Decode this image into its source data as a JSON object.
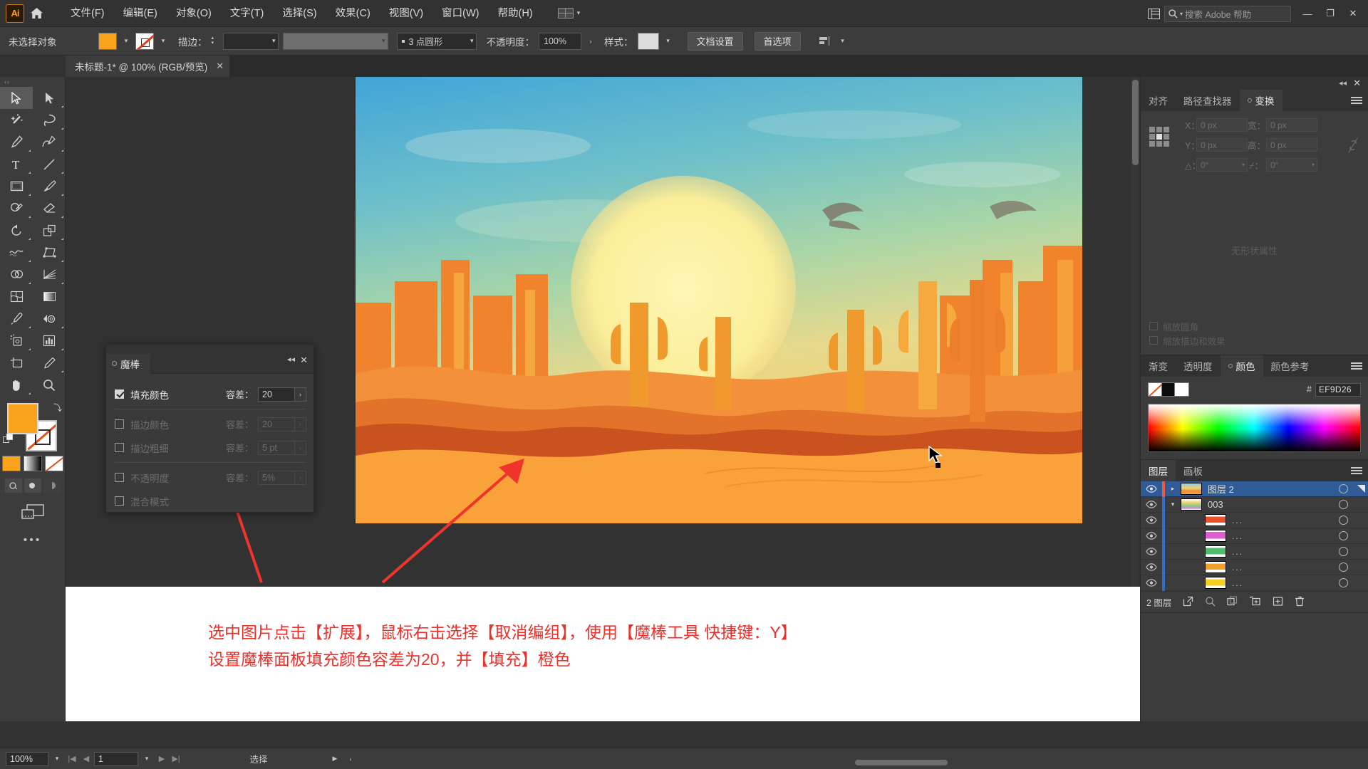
{
  "app": {
    "name": "Adobe Illustrator",
    "logo_text": "Ai"
  },
  "menubar": {
    "items": [
      "文件(F)",
      "编辑(E)",
      "对象(O)",
      "文字(T)",
      "选择(S)",
      "效果(C)",
      "视图(V)",
      "窗口(W)",
      "帮助(H)"
    ],
    "search_placeholder": "搜索 Adobe 帮助",
    "window_buttons": [
      "—",
      "❐",
      "✕"
    ]
  },
  "controlbar": {
    "selection_status": "未选择对象",
    "stroke_label": "描边：",
    "stroke_width": "",
    "stroke_profile": "",
    "brush_label": "3 点圆形",
    "opacity_label": "不透明度：",
    "opacity_value": "100%",
    "style_label": "样式：",
    "doc_setup_button": "文档设置",
    "preferences_button": "首选项"
  },
  "document_tab": {
    "title": "未标题-1* @ 100% (RGB/预览)",
    "close": "✕"
  },
  "toolbar": {
    "tools": [
      {
        "name": "selection-tool",
        "selected": true
      },
      {
        "name": "direct-selection-tool",
        "selected": false
      },
      {
        "name": "magic-wand-tool",
        "selected": false
      },
      {
        "name": "lasso-tool",
        "selected": false
      },
      {
        "name": "pen-tool",
        "selected": false
      },
      {
        "name": "curvature-tool",
        "selected": false
      },
      {
        "name": "type-tool",
        "selected": false
      },
      {
        "name": "line-segment-tool",
        "selected": false
      },
      {
        "name": "rectangle-tool",
        "selected": false
      },
      {
        "name": "paintbrush-tool",
        "selected": false
      },
      {
        "name": "shaper-tool",
        "selected": false
      },
      {
        "name": "eraser-tool",
        "selected": false
      },
      {
        "name": "rotate-tool",
        "selected": false
      },
      {
        "name": "scale-tool",
        "selected": false
      },
      {
        "name": "width-tool",
        "selected": false
      },
      {
        "name": "free-transform-tool",
        "selected": false
      },
      {
        "name": "shape-builder-tool",
        "selected": false
      },
      {
        "name": "perspective-grid-tool",
        "selected": false
      },
      {
        "name": "mesh-tool",
        "selected": false
      },
      {
        "name": "gradient-tool",
        "selected": false
      },
      {
        "name": "eyedropper-tool",
        "selected": false
      },
      {
        "name": "blend-tool",
        "selected": false
      },
      {
        "name": "symbol-sprayer-tool",
        "selected": false
      },
      {
        "name": "column-graph-tool",
        "selected": false
      },
      {
        "name": "artboard-tool",
        "selected": false
      },
      {
        "name": "slice-tool",
        "selected": false
      },
      {
        "name": "hand-tool",
        "selected": false
      },
      {
        "name": "zoom-tool",
        "selected": false
      }
    ],
    "fill_color": "#FBA21C",
    "stroke_color": "none",
    "more_tools": "•••"
  },
  "magic_wand_panel": {
    "tab_label": "魔棒",
    "close": "✕",
    "collapse": "◂◂",
    "rows": [
      {
        "label": "填充颜色",
        "checked": true,
        "tol_label": "容差：",
        "tol_value": "20",
        "enabled": true
      },
      {
        "label": "描边颜色",
        "checked": false,
        "tol_label": "容差：",
        "tol_value": "20",
        "enabled": false
      },
      {
        "label": "描边粗细",
        "checked": false,
        "tol_label": "容差：",
        "tol_value": "5 pt",
        "enabled": false
      },
      {
        "label": "不透明度",
        "checked": false,
        "tol_label": "容差：",
        "tol_value": "5%",
        "enabled": false
      },
      {
        "label": "混合模式",
        "checked": false,
        "tol_label": "",
        "tol_value": "",
        "enabled": false
      }
    ]
  },
  "right_dock": {
    "transform_panel": {
      "tabs": [
        "对齐",
        "路径查找器",
        "变换"
      ],
      "active_tab": "变换",
      "x_label": "X：",
      "x_value": "0 px",
      "y_label": "Y：",
      "y_value": "0 px",
      "w_label": "宽：",
      "w_value": "0 px",
      "h_label": "高：",
      "h_value": "0 px",
      "angle_label": "△：",
      "angle_value": "0°",
      "shear_label": "⌿：",
      "shear_value": "0°",
      "no_attrs": "无形状属性",
      "check_scale_corners": "缩放圆角",
      "check_scale_strokes": "缩放描边和效果"
    },
    "color_panel": {
      "tabs": [
        "渐变",
        "透明度",
        "颜色",
        "颜色参考"
      ],
      "active_tab": "颜色",
      "hex_prefix": "#",
      "hex_value": "EF9D26"
    },
    "layers_panel": {
      "tabs": [
        "图层",
        "画板"
      ],
      "active_tab": "图层",
      "rows": [
        {
          "name": "图层 2",
          "selected": true,
          "indent": 0,
          "arrow": "▸",
          "color": "#f05a3c",
          "thumb_kind": "art",
          "dots": ""
        },
        {
          "name": "003",
          "selected": false,
          "indent": 1,
          "arrow": "▾",
          "color": "#2e6fd0",
          "thumb_kind": "group",
          "dots": ""
        },
        {
          "name": "",
          "selected": false,
          "indent": 2,
          "arrow": "",
          "color": "#2e6fd0",
          "thumb_kind": "orange",
          "dots": "..."
        },
        {
          "name": "",
          "selected": false,
          "indent": 2,
          "arrow": "",
          "color": "#2e6fd0",
          "thumb_kind": "pink",
          "dots": "..."
        },
        {
          "name": "",
          "selected": false,
          "indent": 2,
          "arrow": "",
          "color": "#2e6fd0",
          "thumb_kind": "green",
          "dots": "..."
        },
        {
          "name": "",
          "selected": false,
          "indent": 2,
          "arrow": "",
          "color": "#2e6fd0",
          "thumb_kind": "amber",
          "dots": "..."
        },
        {
          "name": "",
          "selected": false,
          "indent": 2,
          "arrow": "",
          "color": "#2e6fd0",
          "thumb_kind": "yellow",
          "dots": "..."
        }
      ],
      "footer_count": "2 图层"
    }
  },
  "annotation": {
    "line1": "选中图片点击【扩展】，鼠标右击选择【取消编组】，使用【魔棒工具 快捷键：Y】",
    "line2": "设置魔棒面板填充颜色容差为20，并【填充】橙色",
    "color": "#EE2F2A"
  },
  "statusbar": {
    "zoom_value": "100%",
    "page_value": "1",
    "tool_status": "选择"
  },
  "artwork": {
    "title": "desert-sunset-illustration",
    "sky_top": "#4DA9D8",
    "sky_mid": "#9FD0B8",
    "sky_low": "#F4D98A",
    "sun": "#FBF2A8",
    "dune_light": "#F9A63A",
    "dune_mid": "#E8742A",
    "dune_dark": "#C4481E"
  }
}
